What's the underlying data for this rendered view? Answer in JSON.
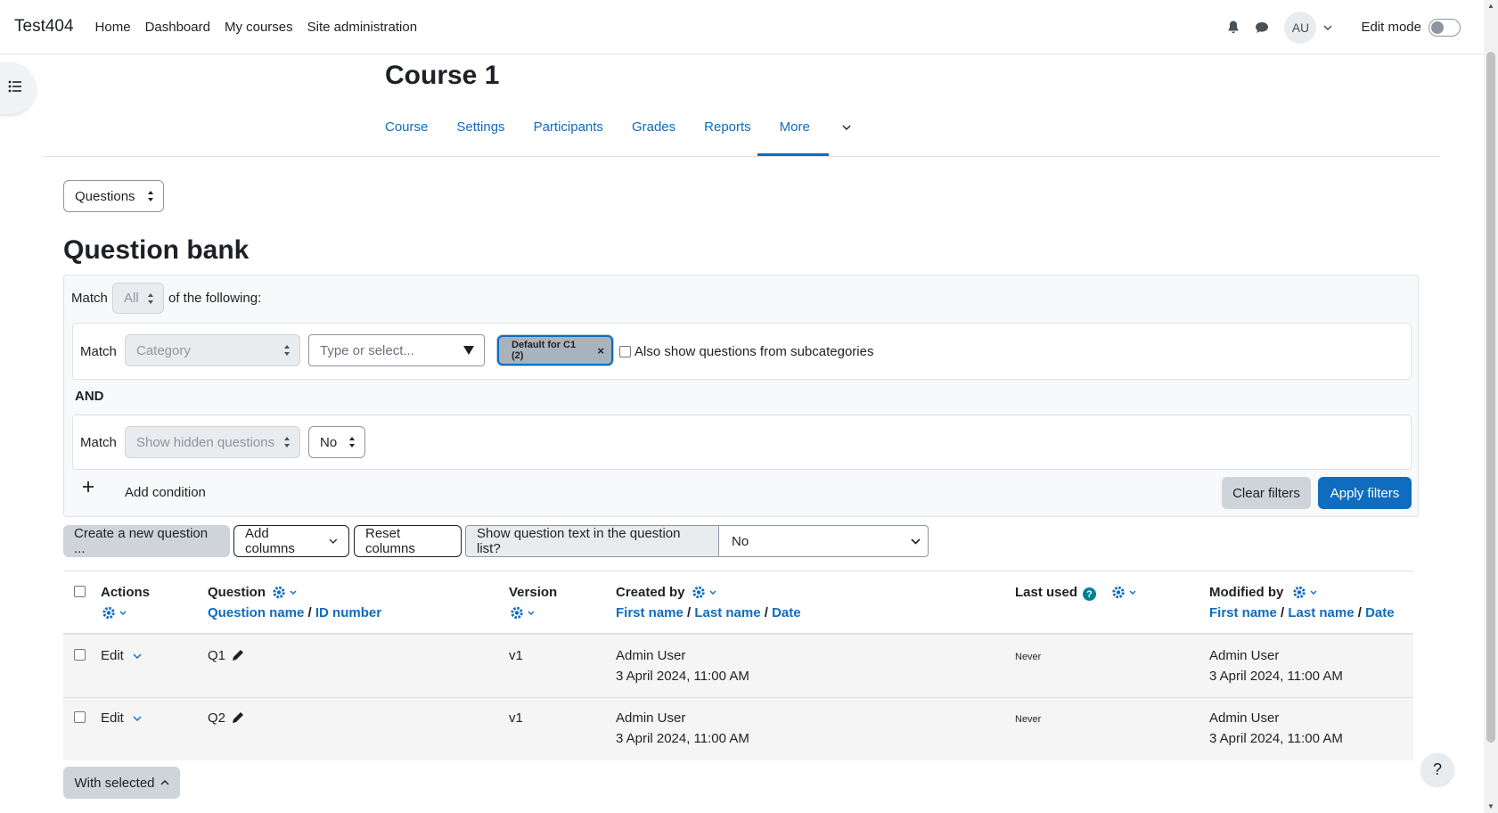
{
  "navbar": {
    "brand": "Test404",
    "links": [
      "Home",
      "Dashboard",
      "My courses",
      "Site administration"
    ],
    "avatar_initials": "AU",
    "edit_mode_label": "Edit mode"
  },
  "course": {
    "title": "Course 1",
    "tabs": [
      "Course",
      "Settings",
      "Participants",
      "Grades",
      "Reports"
    ],
    "more_label": "More"
  },
  "page_select": {
    "value": "Questions"
  },
  "question_bank": {
    "title": "Question bank",
    "match_label": "Match",
    "match_value": "All",
    "of_following": "of the following:",
    "condition1": {
      "match_label": "Match",
      "type": "Category",
      "input_placeholder": "Type or select...",
      "chip": "Default for C1 (2)",
      "subcategories_label": "Also show questions from subcategories"
    },
    "and_label": "AND",
    "condition2": {
      "match_label": "Match",
      "type": "Show hidden questions",
      "value": "No"
    },
    "add_condition": "Add condition",
    "clear_filters": "Clear filters",
    "apply_filters": "Apply filters"
  },
  "toolbar": {
    "create_new": "Create a new question ...",
    "add_columns": "Add columns",
    "reset_columns": "Reset columns",
    "show_text_label": "Show question text in the question list?",
    "show_text_value": "No"
  },
  "table": {
    "headers": {
      "actions": "Actions",
      "question": "Question",
      "question_name": "Question name",
      "id_number": "ID number",
      "version": "Version",
      "created_by": "Created by",
      "first_name": "First name",
      "last_name": "Last name",
      "date": "Date",
      "last_used": "Last used",
      "modified_by": "Modified by",
      "sep": "/"
    },
    "rows": [
      {
        "edit": "Edit",
        "name": "Q1",
        "version": "v1",
        "created_by": "Admin User",
        "created_date": "3 April 2024, 11:00 AM",
        "last_used": "Never",
        "modified_by": "Admin User",
        "modified_date": "3 April 2024, 11:00 AM"
      },
      {
        "edit": "Edit",
        "name": "Q2",
        "version": "v1",
        "created_by": "Admin User",
        "created_date": "3 April 2024, 11:00 AM",
        "last_used": "Never",
        "modified_by": "Admin User",
        "modified_date": "3 April 2024, 11:00 AM"
      }
    ]
  },
  "with_selected": "With selected",
  "help_symbol": "?",
  "icons": {
    "bell": "bell-icon",
    "chat": "chat-icon",
    "drawer": "list-icon",
    "gear": "gear-icon",
    "pencil": "pencil-icon",
    "plus": "plus-icon",
    "close": "close-icon",
    "help": "help-icon"
  },
  "colors": {
    "accent": "#0f6cbf",
    "help": "#008196"
  }
}
